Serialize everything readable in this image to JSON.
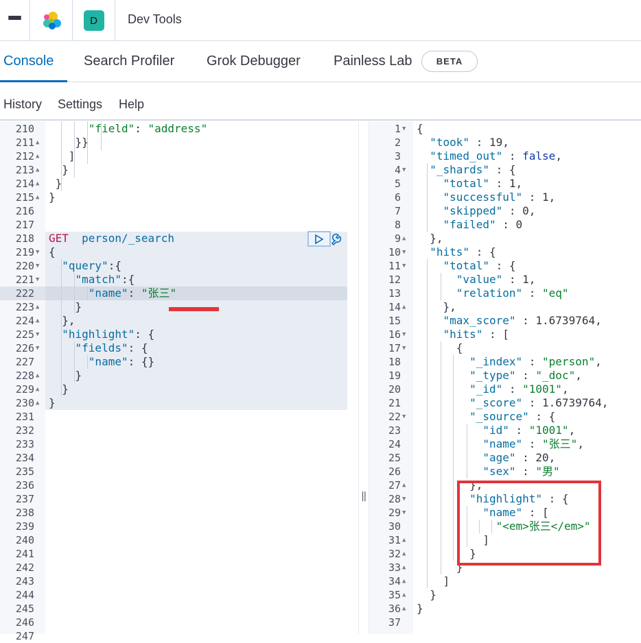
{
  "header": {
    "title": "Dev Tools",
    "space_initial": "D"
  },
  "tabs": [
    {
      "label": "Console"
    },
    {
      "label": "Search Profiler"
    },
    {
      "label": "Grok Debugger"
    },
    {
      "label": "Painless Lab"
    }
  ],
  "beta_badge": "BETA",
  "submenu": {
    "history": "History",
    "settings": "Settings",
    "help": "Help"
  },
  "request_lines": [
    {
      "n": "210",
      "fold": "",
      "html": "      <span class='s'>\"field\"</span>: <span class='s'>\"address\"</span>"
    },
    {
      "n": "211",
      "fold": "▲",
      "html": "    }}"
    },
    {
      "n": "212",
      "fold": "▲",
      "html": "   ]"
    },
    {
      "n": "213",
      "fold": "▲",
      "html": "  }"
    },
    {
      "n": "214",
      "fold": "▲",
      "html": " }"
    },
    {
      "n": "215",
      "fold": "▲",
      "html": "}"
    },
    {
      "n": "216",
      "fold": "",
      "html": ""
    },
    {
      "n": "217",
      "fold": "",
      "html": ""
    },
    {
      "n": "218",
      "fold": "",
      "html": "<span class='m'>GET</span>  <span class='k'>person/_search</span>"
    },
    {
      "n": "219",
      "fold": "▼",
      "html": "{"
    },
    {
      "n": "220",
      "fold": "▼",
      "html": "  <span class='k'>\"query\"</span>:{"
    },
    {
      "n": "221",
      "fold": "▼",
      "html": "    <span class='k'>\"match\"</span>:{"
    },
    {
      "n": "222",
      "fold": "",
      "html": "      <span class='k'>\"name\"</span>: <span class='s'>\"张三\"</span>"
    },
    {
      "n": "223",
      "fold": "▲",
      "html": "    }"
    },
    {
      "n": "224",
      "fold": "▲",
      "html": "  },"
    },
    {
      "n": "225",
      "fold": "▼",
      "html": "  <span class='k'>\"highlight\"</span>: {"
    },
    {
      "n": "226",
      "fold": "▼",
      "html": "    <span class='k'>\"fields\"</span>: {"
    },
    {
      "n": "227",
      "fold": "",
      "html": "      <span class='k'>\"name\"</span>: {}"
    },
    {
      "n": "228",
      "fold": "▲",
      "html": "    }"
    },
    {
      "n": "229",
      "fold": "▲",
      "html": "  }"
    },
    {
      "n": "230",
      "fold": "▲",
      "html": "}"
    },
    {
      "n": "231",
      "fold": "",
      "html": ""
    },
    {
      "n": "232",
      "fold": "",
      "html": ""
    },
    {
      "n": "233",
      "fold": "",
      "html": ""
    },
    {
      "n": "234",
      "fold": "",
      "html": ""
    },
    {
      "n": "235",
      "fold": "",
      "html": ""
    },
    {
      "n": "236",
      "fold": "",
      "html": ""
    },
    {
      "n": "237",
      "fold": "",
      "html": ""
    },
    {
      "n": "238",
      "fold": "",
      "html": ""
    },
    {
      "n": "239",
      "fold": "",
      "html": ""
    },
    {
      "n": "240",
      "fold": "",
      "html": ""
    },
    {
      "n": "241",
      "fold": "",
      "html": ""
    },
    {
      "n": "242",
      "fold": "",
      "html": ""
    },
    {
      "n": "243",
      "fold": "",
      "html": ""
    },
    {
      "n": "244",
      "fold": "",
      "html": ""
    },
    {
      "n": "245",
      "fold": "",
      "html": ""
    },
    {
      "n": "246",
      "fold": "",
      "html": ""
    },
    {
      "n": "247",
      "fold": "",
      "html": ""
    }
  ],
  "response_lines": [
    {
      "n": "1",
      "fold": "▼",
      "html": "{"
    },
    {
      "n": "2",
      "fold": "",
      "html": "  <span class='k'>\"took\"</span> : 19,"
    },
    {
      "n": "3",
      "fold": "",
      "html": "  <span class='k'>\"timed_out\"</span> : <span class='b'>false</span>,"
    },
    {
      "n": "4",
      "fold": "▼",
      "html": "  <span class='k'>\"_shards\"</span> : {"
    },
    {
      "n": "5",
      "fold": "",
      "html": "    <span class='k'>\"total\"</span> : 1,"
    },
    {
      "n": "6",
      "fold": "",
      "html": "    <span class='k'>\"successful\"</span> : 1,"
    },
    {
      "n": "7",
      "fold": "",
      "html": "    <span class='k'>\"skipped\"</span> : 0,"
    },
    {
      "n": "8",
      "fold": "",
      "html": "    <span class='k'>\"failed\"</span> : 0"
    },
    {
      "n": "9",
      "fold": "▲",
      "html": "  },"
    },
    {
      "n": "10",
      "fold": "▼",
      "html": "  <span class='k'>\"hits\"</span> : {"
    },
    {
      "n": "11",
      "fold": "▼",
      "html": "    <span class='k'>\"total\"</span> : {"
    },
    {
      "n": "12",
      "fold": "",
      "html": "      <span class='k'>\"value\"</span> : 1,"
    },
    {
      "n": "13",
      "fold": "",
      "html": "      <span class='k'>\"relation\"</span> : <span class='s'>\"eq\"</span>"
    },
    {
      "n": "14",
      "fold": "▲",
      "html": "    },"
    },
    {
      "n": "15",
      "fold": "",
      "html": "    <span class='k'>\"max_score\"</span> : 1.6739764,"
    },
    {
      "n": "16",
      "fold": "▼",
      "html": "    <span class='k'>\"hits\"</span> : ["
    },
    {
      "n": "17",
      "fold": "▼",
      "html": "      {"
    },
    {
      "n": "18",
      "fold": "",
      "html": "        <span class='k'>\"_index\"</span> : <span class='s'>\"person\"</span>,"
    },
    {
      "n": "19",
      "fold": "",
      "html": "        <span class='k'>\"_type\"</span> : <span class='s'>\"_doc\"</span>,"
    },
    {
      "n": "20",
      "fold": "",
      "html": "        <span class='k'>\"_id\"</span> : <span class='s'>\"1001\"</span>,"
    },
    {
      "n": "21",
      "fold": "",
      "html": "        <span class='k'>\"_score\"</span> : 1.6739764,"
    },
    {
      "n": "22",
      "fold": "▼",
      "html": "        <span class='k'>\"_source\"</span> : {"
    },
    {
      "n": "23",
      "fold": "",
      "html": "          <span class='k'>\"id\"</span> : <span class='s'>\"1001\"</span>,"
    },
    {
      "n": "24",
      "fold": "",
      "html": "          <span class='k'>\"name\"</span> : <span class='s'>\"张三\"</span>,"
    },
    {
      "n": "25",
      "fold": "",
      "html": "          <span class='k'>\"age\"</span> : 20,"
    },
    {
      "n": "26",
      "fold": "",
      "html": "          <span class='k'>\"sex\"</span> : <span class='s'>\"男\"</span>"
    },
    {
      "n": "27",
      "fold": "▲",
      "html": "        },"
    },
    {
      "n": "28",
      "fold": "▼",
      "html": "        <span class='k'>\"highlight\"</span> : {"
    },
    {
      "n": "29",
      "fold": "▼",
      "html": "          <span class='k'>\"name\"</span> : ["
    },
    {
      "n": "30",
      "fold": "",
      "html": "            <span class='s'>\"&lt;em&gt;张三&lt;/em&gt;\"</span>"
    },
    {
      "n": "31",
      "fold": "▲",
      "html": "          ]"
    },
    {
      "n": "32",
      "fold": "▲",
      "html": "        }"
    },
    {
      "n": "33",
      "fold": "▲",
      "html": "      }"
    },
    {
      "n": "34",
      "fold": "▲",
      "html": "    ]"
    },
    {
      "n": "35",
      "fold": "▲",
      "html": "  }"
    },
    {
      "n": "36",
      "fold": "▲",
      "html": "}"
    },
    {
      "n": "37",
      "fold": "",
      "html": ""
    }
  ],
  "colors": {
    "accent": "#006bb8",
    "annotation_red": "#e2363b",
    "space_avatar": "#20b4a4"
  }
}
